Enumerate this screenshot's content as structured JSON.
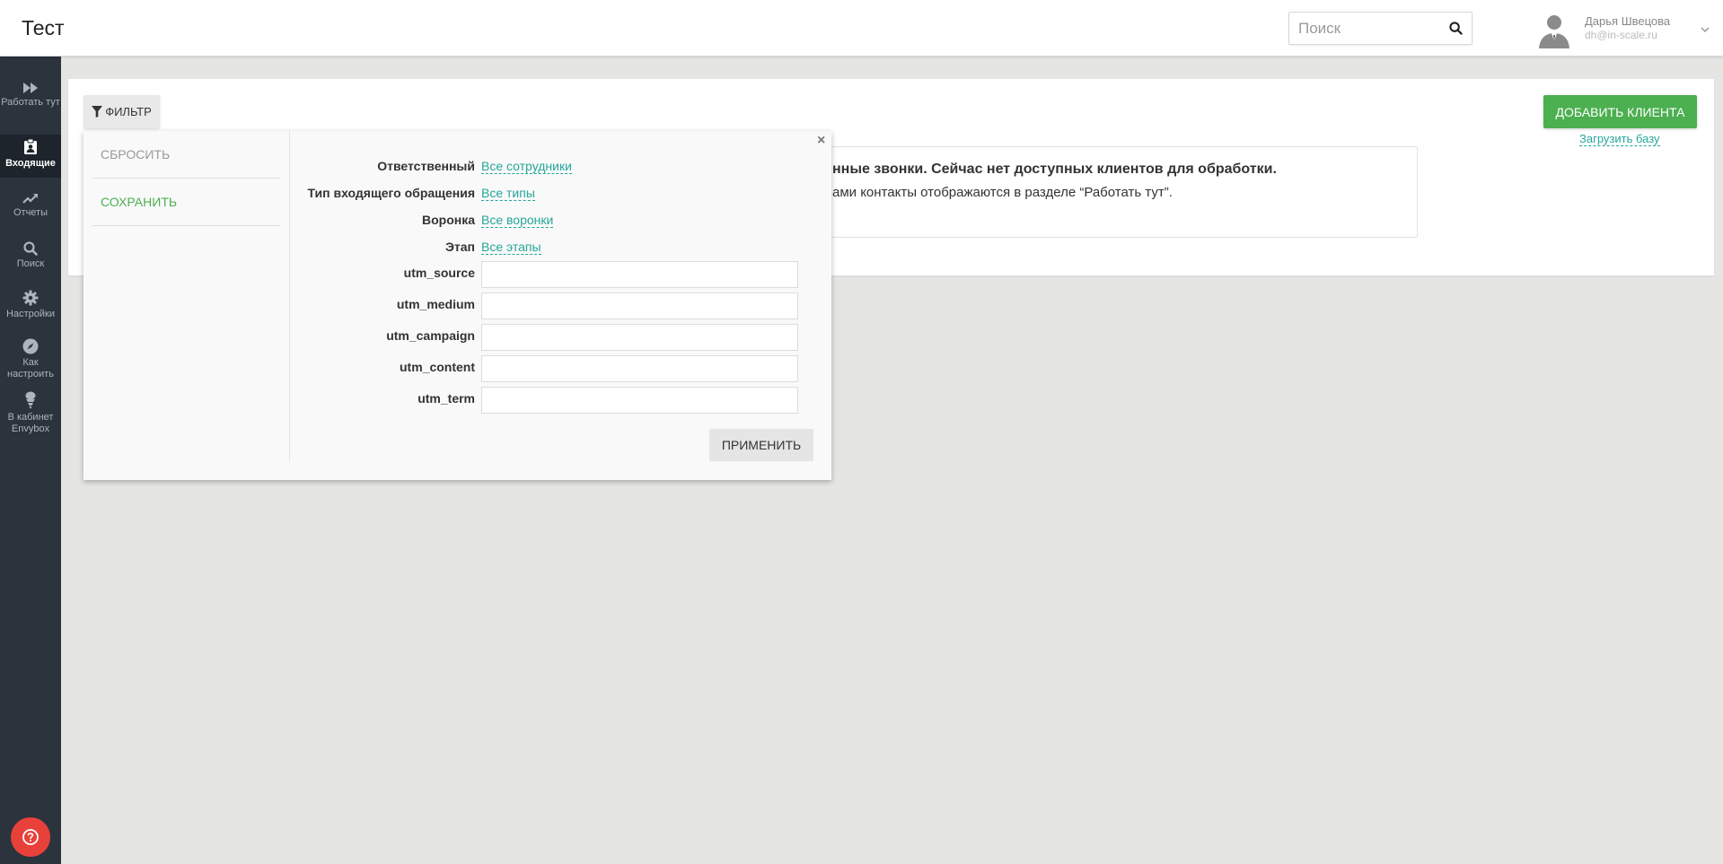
{
  "header": {
    "title": "Тест",
    "search_placeholder": "Поиск",
    "user_name": "Дарья Швецова",
    "user_email": "dh@in-scale.ru"
  },
  "sidebar": {
    "items": [
      {
        "label": "Работать тут",
        "icon": "fast-forward-icon"
      },
      {
        "label": "Входящие",
        "icon": "inbox-badge-icon",
        "active": true
      },
      {
        "label": "Отчеты",
        "icon": "trending-up-icon"
      },
      {
        "label": "Поиск",
        "icon": "search-icon"
      },
      {
        "label": "Настройки",
        "icon": "gear-icon"
      },
      {
        "label": "Как настроить",
        "icon": "compass-icon"
      },
      {
        "label": "В кабинет Envybox",
        "icon": "envybox-icon"
      }
    ],
    "help_icon": "question-icon"
  },
  "main": {
    "filter_label": "ФИЛЬТР",
    "add_client_label": "ДОБАВИТЬ КЛИЕНТА",
    "load_base_label": "Загрузить базу",
    "info_line1": "нные звонки. Сейчас нет доступных клиентов для обработки.",
    "info_line2": "ами контакты отображаются в разделе “Работать тут”."
  },
  "filter": {
    "reset_label": "СБРОСИТЬ",
    "save_label": "СОХРАНИТЬ",
    "close_symbol": "×",
    "responsible_label": "Ответственный",
    "responsible_value": "Все сотрудники",
    "type_label": "Тип входящего обращения",
    "type_value": "Все типы",
    "funnel_label": "Воронка",
    "funnel_value": "Все воронки",
    "stage_label": "Этап",
    "stage_value": "Все этапы",
    "utm_source_label": "utm_source",
    "utm_source_value": "",
    "utm_medium_label": "utm_medium",
    "utm_medium_value": "",
    "utm_campaign_label": "utm_campaign",
    "utm_campaign_value": "",
    "utm_content_label": "utm_content",
    "utm_content_value": "",
    "utm_term_label": "utm_term",
    "utm_term_value": "",
    "apply_label": "ПРИМЕНИТЬ"
  },
  "colors": {
    "accent": "#26a69a",
    "primary_button": "#4caf50",
    "sidebar": "#2b333d",
    "help": "#e8413a"
  }
}
